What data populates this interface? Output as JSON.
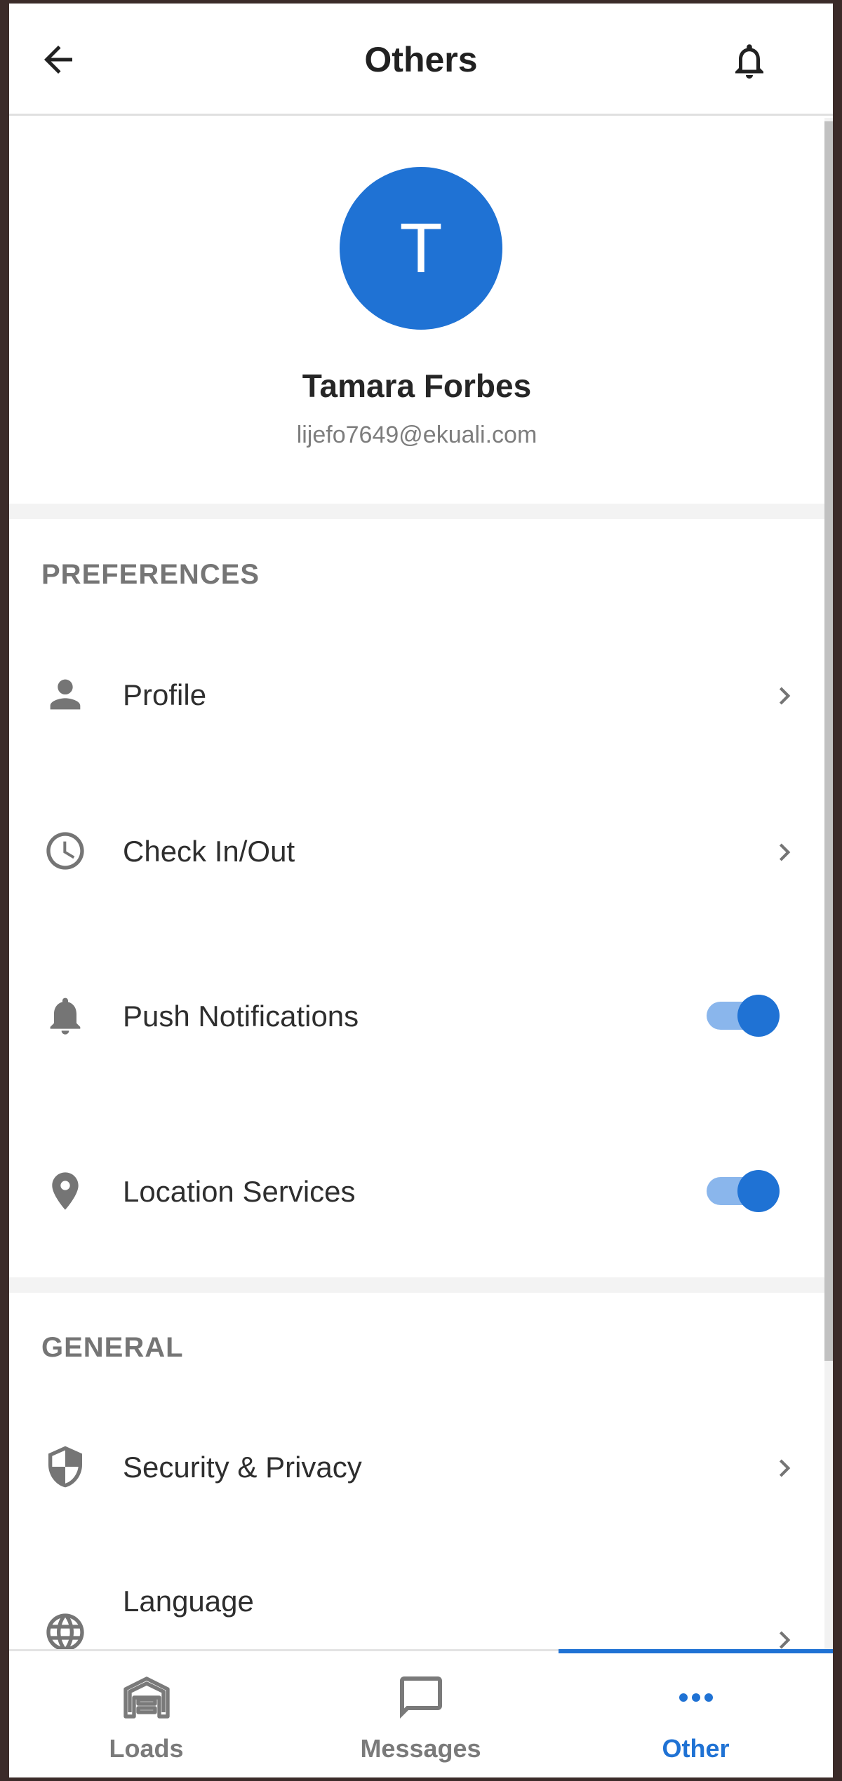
{
  "header": {
    "title": "Others"
  },
  "profile": {
    "initial": "T",
    "name": "Tamara Forbes",
    "email": "lijefo7649@ekuali.com"
  },
  "sections": {
    "preferences": {
      "title": "PREFERENCES",
      "items": [
        {
          "label": "Profile",
          "icon": "person-icon",
          "control": "chevron"
        },
        {
          "label": "Check In/Out",
          "icon": "clock-icon",
          "control": "chevron"
        },
        {
          "label": "Push Notifications",
          "icon": "bell-icon",
          "control": "toggle",
          "value": true
        },
        {
          "label": "Location Services",
          "icon": "location-pin-icon",
          "control": "toggle",
          "value": true
        }
      ]
    },
    "general": {
      "title": "GENERAL",
      "items": [
        {
          "label": "Security & Privacy",
          "icon": "shield-icon",
          "control": "chevron"
        },
        {
          "label": "Language",
          "icon": "globe-icon",
          "control": "chevron"
        }
      ]
    }
  },
  "tabbar": {
    "tabs": [
      {
        "label": "Loads",
        "icon": "warehouse-icon",
        "active": false
      },
      {
        "label": "Messages",
        "icon": "message-icon",
        "active": false
      },
      {
        "label": "Other",
        "icon": "more-dots-icon",
        "active": true
      }
    ]
  },
  "colors": {
    "accent": "#1f72d4",
    "toggle_track": "#8ab6ec",
    "text_muted": "#757575"
  }
}
